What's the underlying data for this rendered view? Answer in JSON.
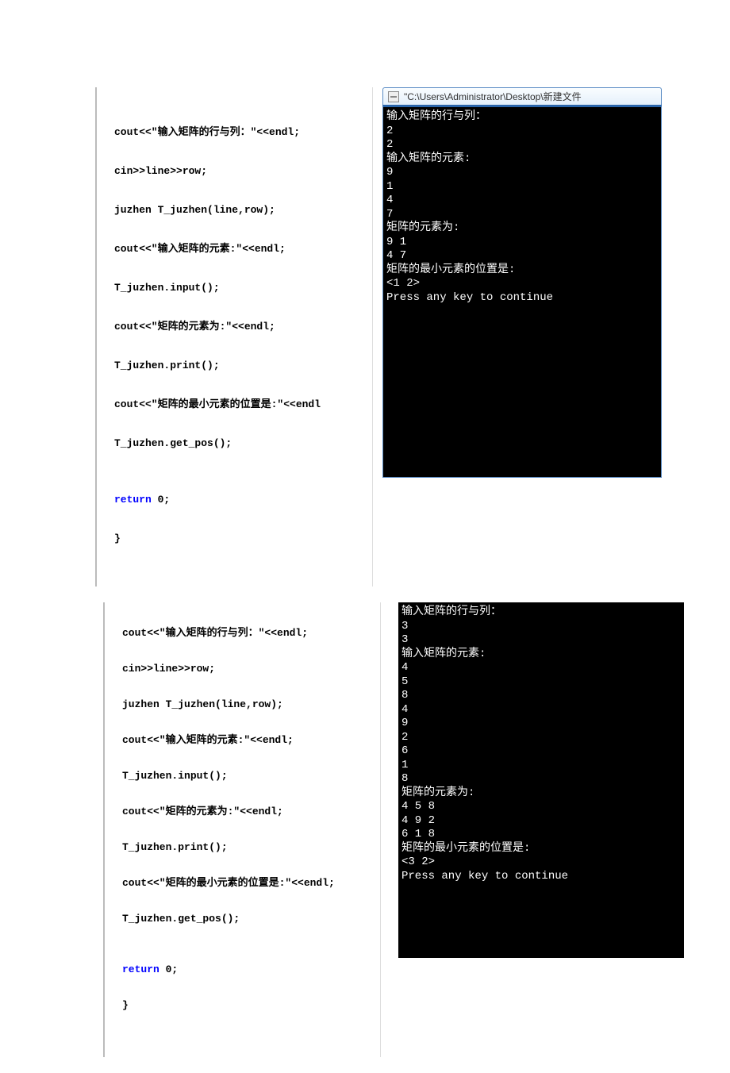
{
  "code1": {
    "l1a": "cout<<\"",
    "l1b": "输入矩阵的行与列：\"",
    "l1c": "<<endl;",
    "l2": "cin>>line>>row;",
    "l3": "juzhen T_juzhen(line,row);",
    "l4a": "cout<<\"",
    "l4b": "输入矩阵的元素:\"",
    "l4c": "<<endl;",
    "l5": "T_juzhen.input();",
    "l6a": "cout<<\"",
    "l6b": "矩阵的元素为:\"",
    "l6c": "<<endl;",
    "l7": "T_juzhen.print();",
    "l8a": "cout<<\"",
    "l8b": "矩阵的最小元素的位置是:\"",
    "l8c": "<<endl",
    "l9": "T_juzhen.get_pos();",
    "l10": "return",
    "l10b": " 0;",
    "l11": "}"
  },
  "term1": {
    "title": "\"C:\\Users\\Administrator\\Desktop\\新建文件",
    "body": "输入矩阵的行与列：\n2\n2\n输入矩阵的元素:\n9\n1\n4\n7\n矩阵的元素为:\n9 1\n4 7\n矩阵的最小元素的位置是:\n<1 2>\nPress any key to continue"
  },
  "code2": {
    "l1a": "cout<<\"",
    "l1b": "输入矩阵的行与列：\"",
    "l1c": "<<endl;",
    "l2": "cin>>line>>row;",
    "l3": "juzhen T_juzhen(line,row);",
    "l4a": "cout<<\"",
    "l4b": "输入矩阵的元素:\"",
    "l4c": "<<endl;",
    "l5": "T_juzhen.input();",
    "l6a": "cout<<\"",
    "l6b": "矩阵的元素为:\"",
    "l6c": "<<endl;",
    "l7": "T_juzhen.print();",
    "l8a": "cout<<\"",
    "l8b": "矩阵的最小元素的位置是:\"",
    "l8c": "<<endl;",
    "l9": "T_juzhen.get_pos();",
    "l10": "return",
    "l10b": " 0;",
    "l11": "}"
  },
  "term2": {
    "body": "输入矩阵的行与列：\n3\n3\n输入矩阵的元素:\n4\n5\n8\n4\n9\n2\n6\n1\n8\n矩阵的元素为:\n4 5 8\n4 9 2\n6 1 8\n矩阵的最小元素的位置是:\n<3 2>\nPress any key to continue"
  }
}
